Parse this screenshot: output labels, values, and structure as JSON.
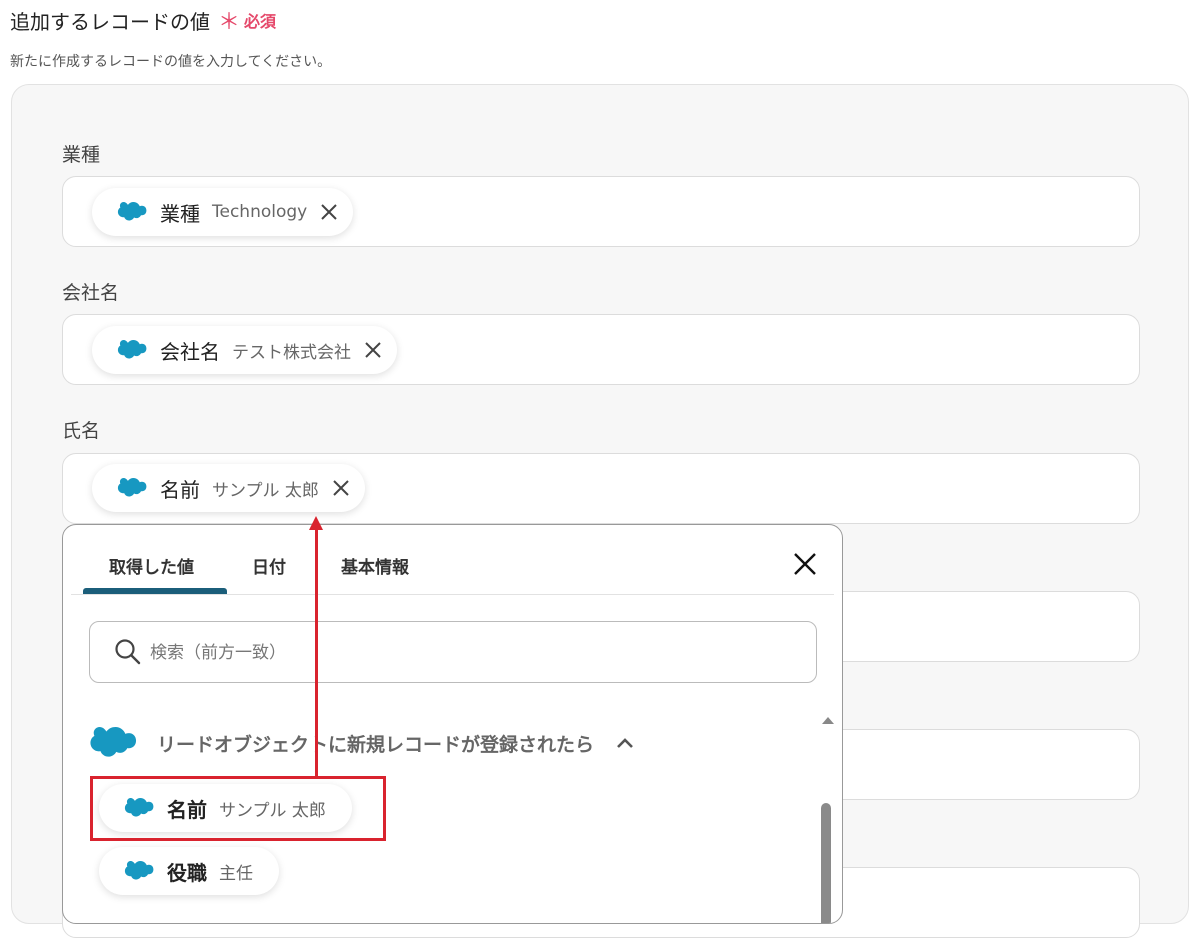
{
  "header": {
    "title": "追加するレコードの値",
    "required_mark": "＊",
    "required_label": "必須",
    "description": "新たに作成するレコードの値を入力してください。"
  },
  "fields": [
    {
      "label": "業種",
      "chip": {
        "name": "業種",
        "value": "Technology"
      }
    },
    {
      "label": "会社名",
      "chip": {
        "name": "会社名",
        "value": "テスト株式会社"
      }
    },
    {
      "label": "氏名",
      "chip": {
        "name": "名前",
        "value": "サンプル 太郎"
      }
    }
  ],
  "picker": {
    "tabs": [
      "取得した値",
      "日付",
      "基本情報"
    ],
    "active_tab": 0,
    "search_placeholder": "検索（前方一致）",
    "group": {
      "label": "リードオブジェクトに新規レコードが登録されたら",
      "expanded": true
    },
    "items": [
      {
        "name": "名前",
        "value": "サンプル 太郎"
      },
      {
        "name": "役職",
        "value": "主任"
      }
    ]
  },
  "colors": {
    "required": "#e5486a",
    "tab_underline": "#1b5e7a",
    "annotation": "#d9232e",
    "salesforce_cloud": "#1798c1"
  },
  "icons": [
    "salesforce-cloud-icon",
    "close-icon",
    "search-icon",
    "chevron-up-icon"
  ]
}
